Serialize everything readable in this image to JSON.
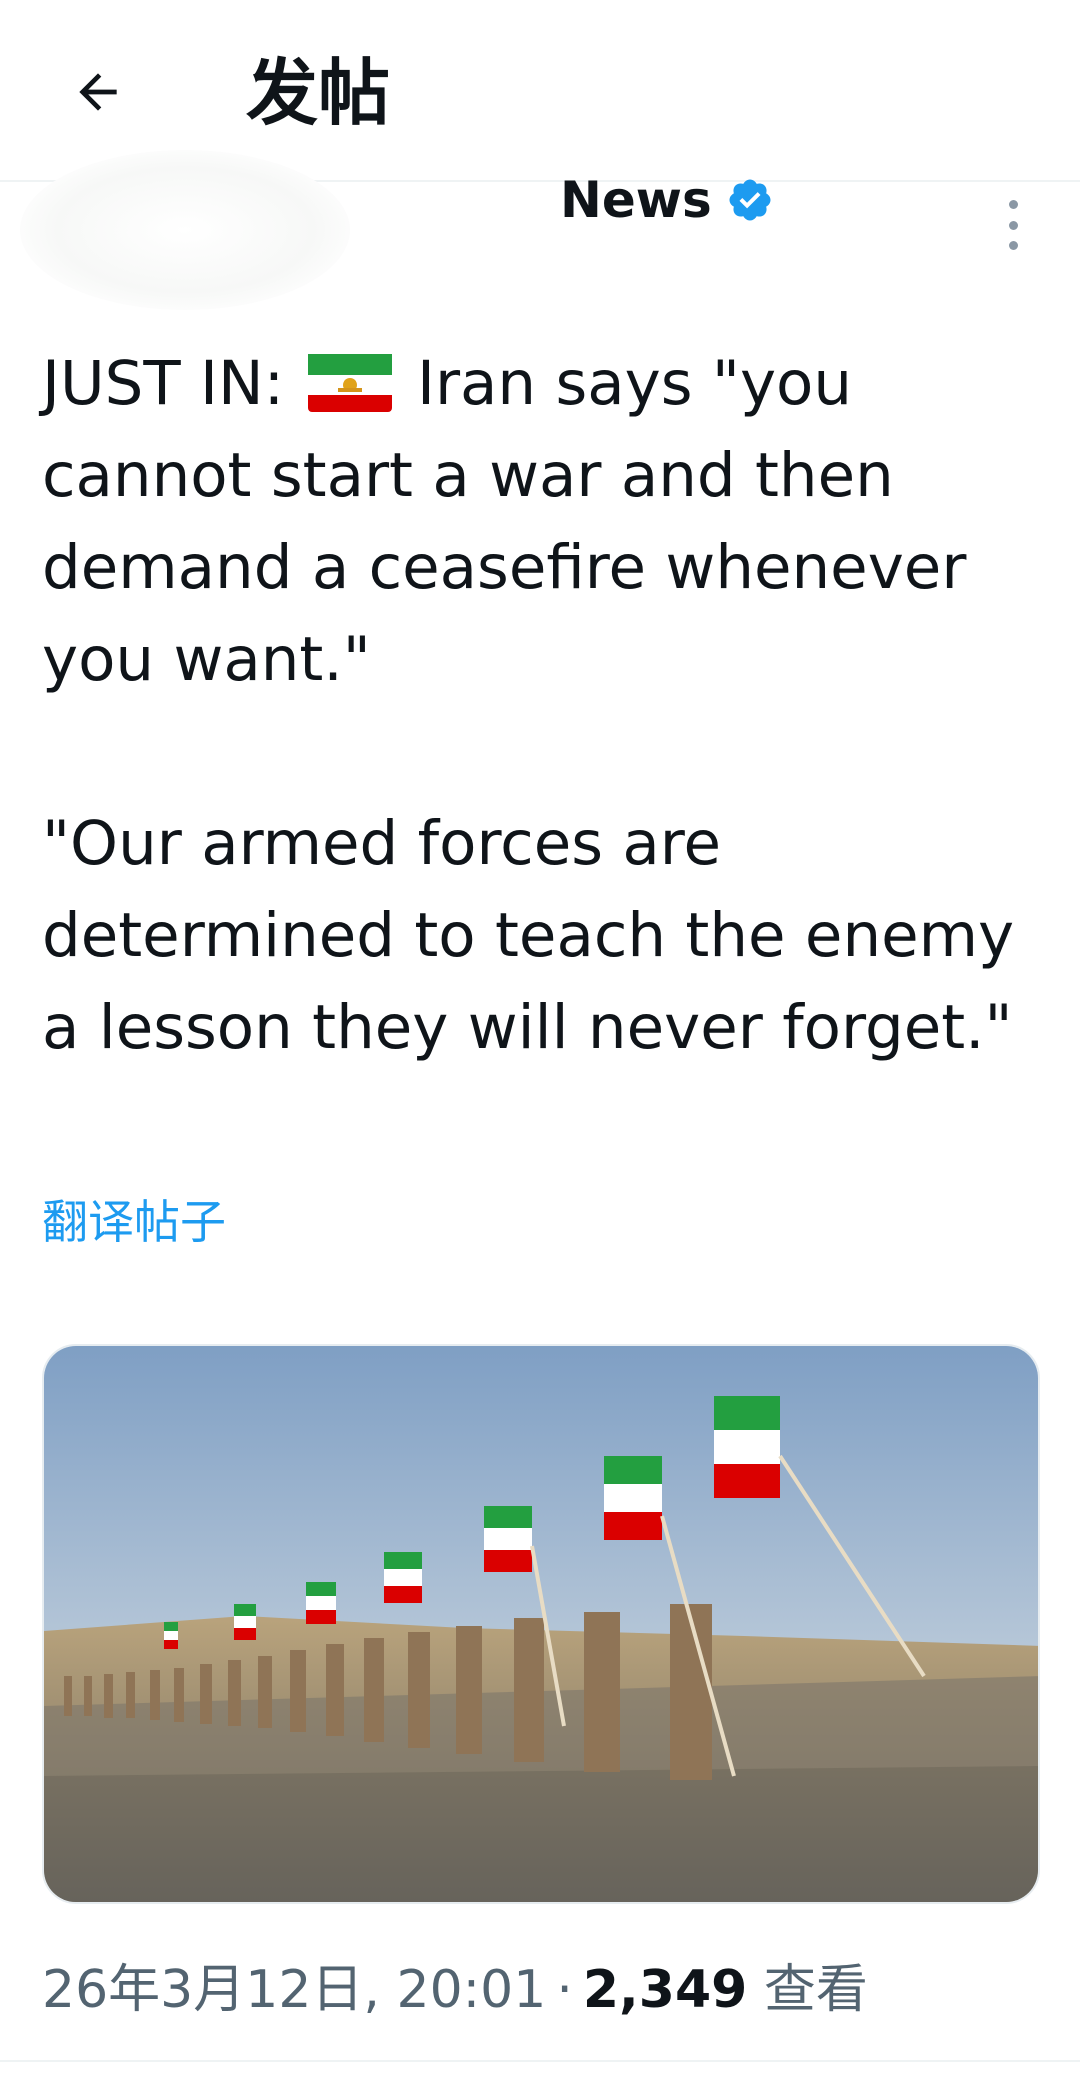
{
  "header": {
    "back_icon": "arrow-left-icon",
    "title": "发帖"
  },
  "author": {
    "name": "News",
    "verified_icon": "verified-badge-icon",
    "verified_color": "#1d9bf0",
    "more_icon": "more-vertical-icon"
  },
  "post": {
    "lead": "JUST IN:",
    "flag_icon": "iran-flag-icon",
    "para1_rest": "Iran says \"you cannot start a war and then demand a ceasefire whenever you want.\"",
    "para2": "\"Our armed forces are determined to teach the enemy a lesson they will never forget.\"",
    "translate_label": "翻译帖子"
  },
  "meta": {
    "timestamp": "26年3月12日, 20:01",
    "separator": "·",
    "views_count": "2,349",
    "views_label": "查看"
  },
  "colors": {
    "accent": "#1d9bf0",
    "text": "#0f1419",
    "secondary": "#536471"
  }
}
